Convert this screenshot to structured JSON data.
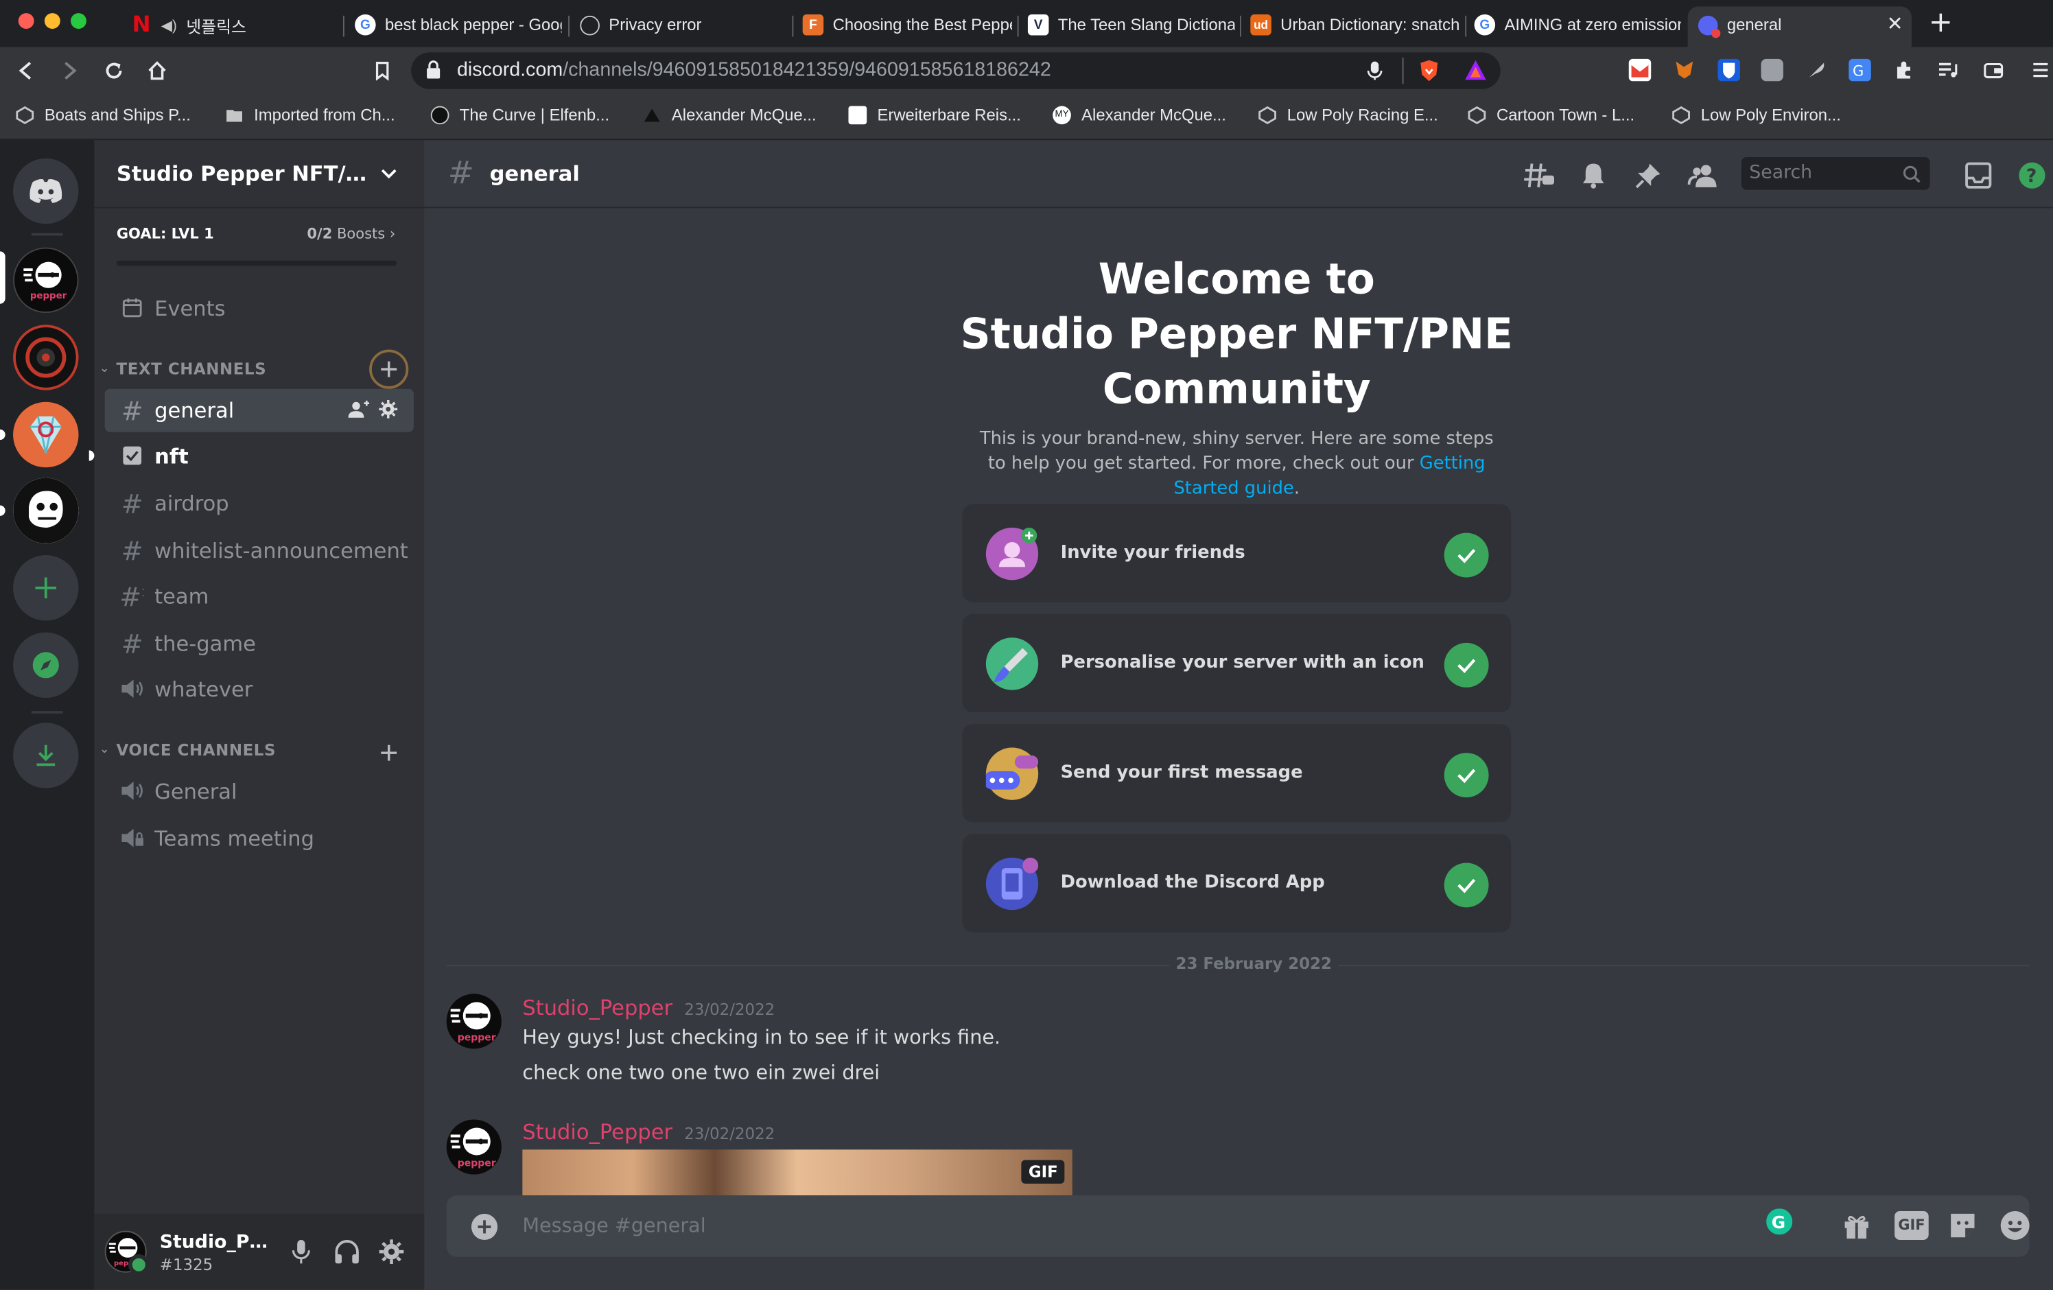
{
  "browser": {
    "tabs": [
      {
        "title": "넷플릭스",
        "favicon": "netflix-icon"
      },
      {
        "title": "best black pepper - Google",
        "favicon": "google-icon"
      },
      {
        "title": "Privacy error",
        "favicon": "globe-icon"
      },
      {
        "title": "Choosing the Best Pepper",
        "favicon": "f-icon"
      },
      {
        "title": "The Teen Slang Dictionary",
        "favicon": "w-icon"
      },
      {
        "title": "Urban Dictionary: snatched",
        "favicon": "ud-icon"
      },
      {
        "title": "AIMING at zero emissions",
        "favicon": "google-icon"
      },
      {
        "title": "general",
        "favicon": "discord-icon"
      }
    ],
    "active_tab_index": 7,
    "url_domain": "discord.com",
    "url_path": "/channels/946091585018421359/946091585618186242",
    "bookmarks": [
      {
        "label": "Boats and Ships P...",
        "icon": "unity-icon"
      },
      {
        "label": "Imported from Ch...",
        "icon": "folder-icon"
      },
      {
        "label": "The Curve | Elfenb...",
        "icon": "curve-icon"
      },
      {
        "label": "Alexander McQue...",
        "icon": "triangle-icon"
      },
      {
        "label": "Erweiterbare Reis...",
        "icon": "car-icon"
      },
      {
        "label": "Alexander McQue...",
        "icon": "my-icon"
      },
      {
        "label": "Low Poly Racing E...",
        "icon": "unity-icon"
      },
      {
        "label": "Cartoon Town - L...",
        "icon": "unity-icon"
      },
      {
        "label": "Low Poly Environ...",
        "icon": "unity-icon"
      }
    ]
  },
  "server": {
    "name": "Studio Pepper NFT/PNE ...",
    "goal_label": "GOAL: LVL 1",
    "boosts_count": "0/2",
    "boosts_label": "Boosts",
    "boost_progress": 0
  },
  "sidebar": {
    "events_label": "Events",
    "text_category": "TEXT CHANNELS",
    "text_channels": [
      {
        "name": "general",
        "icon": "hash-icon",
        "selected": true
      },
      {
        "name": "nft",
        "icon": "checkbox-icon",
        "selected": false
      },
      {
        "name": "airdrop",
        "icon": "hash-icon",
        "selected": false
      },
      {
        "name": "whitelist-announcement",
        "icon": "hash-icon",
        "selected": false
      },
      {
        "name": "team",
        "icon": "hash-thread-icon",
        "selected": false
      },
      {
        "name": "the-game",
        "icon": "hash-icon",
        "selected": false
      },
      {
        "name": "whatever",
        "icon": "speaker-icon",
        "selected": false
      }
    ],
    "voice_category": "VOICE CHANNELS",
    "voice_channels": [
      {
        "name": "General",
        "icon": "speaker-icon"
      },
      {
        "name": "Teams meeting",
        "icon": "speaker-lock-icon"
      }
    ]
  },
  "user": {
    "name": "Studio_Pep...",
    "tag": "#1325",
    "status_color": "#3ba55c"
  },
  "header": {
    "channel": "general",
    "search_placeholder": "Search"
  },
  "welcome": {
    "title_line1": "Welcome to",
    "title_line2": "Studio Pepper NFT/PNE",
    "title_line3": "Community",
    "desc_part1": "This is your brand-new, shiny server. Here are some steps to help you get started. For more, check out our ",
    "desc_link": "Getting Started guide",
    "desc_part2": ".",
    "tasks": [
      {
        "label": "Invite your friends",
        "icon": "invite-friends-icon",
        "done": true
      },
      {
        "label": "Personalise your server with an icon",
        "icon": "paintbrush-icon",
        "done": true
      },
      {
        "label": "Send your first message",
        "icon": "chat-bubble-icon",
        "done": true
      },
      {
        "label": "Download the Discord App",
        "icon": "phone-app-icon",
        "done": true
      }
    ]
  },
  "date_divider": "23 February 2022",
  "messages": [
    {
      "author": "Studio_Pepper",
      "timestamp": "23/02/2022",
      "lines": [
        "Hey guys! Just checking in to see if it works fine.",
        "check one two one two ein zwei drei"
      ]
    },
    {
      "author": "Studio_Pepper",
      "timestamp": "23/02/2022",
      "attachment_badge": "GIF"
    }
  ],
  "composer": {
    "placeholder": "Message #general",
    "gif_label": "GIF"
  },
  "colors": {
    "accent": "#5865f2",
    "author": "#e0416d",
    "link": "#00aff4",
    "success": "#3ba55c"
  }
}
